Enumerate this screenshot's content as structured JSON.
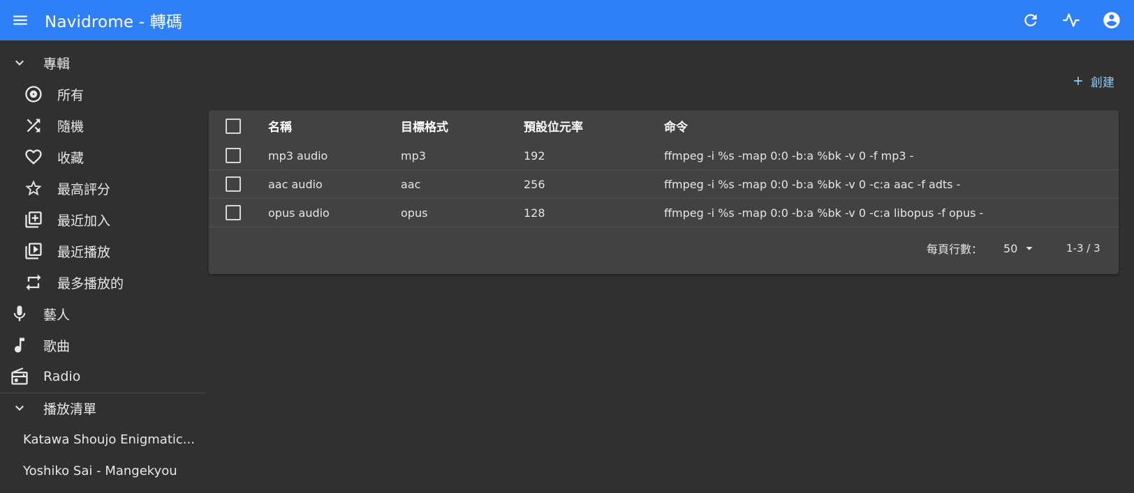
{
  "appbar": {
    "title": "Navidrome - 轉碼",
    "icons": [
      "menu-icon",
      "refresh-icon",
      "activity-icon",
      "account-circle-icon"
    ],
    "color": "#2f80f7"
  },
  "sidebar": {
    "albums_section": "專輯",
    "albums": [
      {
        "label": "所有",
        "icon": "album-icon"
      },
      {
        "label": "隨機",
        "icon": "shuffle-icon"
      },
      {
        "label": "收藏",
        "icon": "heart-icon"
      },
      {
        "label": "最高評分",
        "icon": "star-icon"
      },
      {
        "label": "最近加入",
        "icon": "library-add-icon"
      },
      {
        "label": "最近播放",
        "icon": "video-library-icon"
      },
      {
        "label": "最多播放的",
        "icon": "repeat-icon"
      }
    ],
    "artists": "藝人",
    "songs": "歌曲",
    "radio": "Radio",
    "playlists_section": "播放清單",
    "playlists": [
      "Katawa Shoujo Enigmatic...",
      "Yoshiko Sai - Mangekyou"
    ]
  },
  "toolbar": {
    "create_label": "創建",
    "accent": "#90caf9"
  },
  "table": {
    "headers": {
      "name": "名稱",
      "format": "目標格式",
      "bitrate": "預設位元率",
      "command": "命令"
    },
    "rows": [
      {
        "name": "mp3 audio",
        "format": "mp3",
        "bitrate": "192",
        "command": "ffmpeg -i %s -map 0:0 -b:a %bk -v 0 -f mp3 -"
      },
      {
        "name": "aac audio",
        "format": "aac",
        "bitrate": "256",
        "command": "ffmpeg -i %s -map 0:0 -b:a %bk -v 0 -c:a aac -f adts -"
      },
      {
        "name": "opus audio",
        "format": "opus",
        "bitrate": "128",
        "command": "ffmpeg -i %s -map 0:0 -b:a %bk -v 0 -c:a libopus -f opus -"
      }
    ]
  },
  "pagination": {
    "rows_per_page_label": "每頁行數：",
    "rows_per_page": "50",
    "range": "1-3 / 3"
  }
}
